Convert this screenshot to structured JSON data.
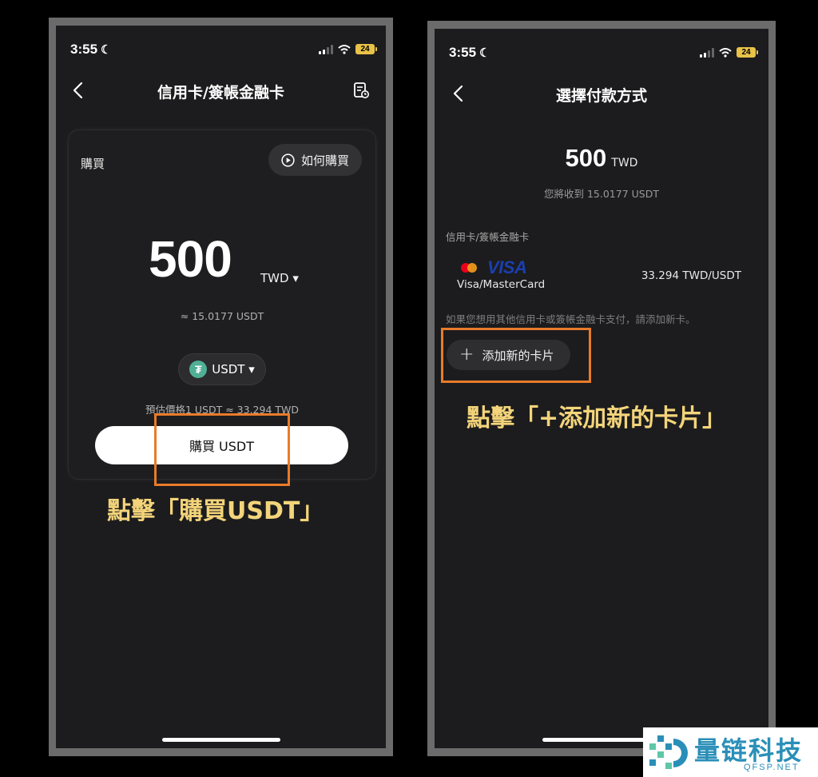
{
  "left_screen": {
    "status": {
      "time": "3:55",
      "battery": "24"
    },
    "nav": {
      "title": "信用卡/簽帳金融卡"
    },
    "buy_card": {
      "label": "購買",
      "howto_label": "如何購買",
      "amount": "500",
      "currency": "TWD ▾",
      "approx": "≈ 15.0177 USDT",
      "coin": "USDT ▾",
      "rate": "預估價格1 USDT ≈ 33.294 TWD",
      "buy_button": "購買 USDT"
    },
    "caption": "點擊「購買USDT」"
  },
  "right_screen": {
    "status": {
      "time": "3:55",
      "battery": "24"
    },
    "nav": {
      "title": "選擇付款方式"
    },
    "amount": "500",
    "currency": "TWD",
    "receive": "您將收到 15.0177 USDT",
    "section_title": "信用卡/簽帳金融卡",
    "payment_method": {
      "logo_text": "VISA",
      "name": "Visa/MasterCard",
      "rate": "33.294 TWD/USDT"
    },
    "hint": "如果您想用其他信用卡或簽帳金融卡支付，請添加新卡。",
    "add_card_button": "添加新的卡片",
    "caption": "點擊「+添加新的卡片」"
  },
  "watermark": {
    "name": "量链科技",
    "site": "QFSP.NET"
  },
  "colors": {
    "highlight": "#e87b2a",
    "caption": "#f3d47a",
    "usdt": "#50af95",
    "visa": "#1a3fb0"
  }
}
